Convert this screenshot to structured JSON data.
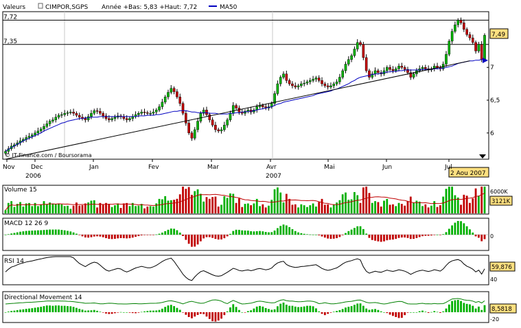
{
  "header": {
    "valeurs_label": "Valeurs",
    "symbol": "CIMPOR,SGPS",
    "range_text": "Année +Bas: 5,83 +Haut: 7,72",
    "ma_label": "MA50"
  },
  "colors": {
    "up": "#00b000",
    "down": "#c00000",
    "ma": "#0000c0",
    "trend": "#000000",
    "highlight": "#ffe080",
    "volume_avg": "#c00000",
    "dm_line": "#008000"
  },
  "chart_data": [
    {
      "type": "candlestick",
      "title": "CIMPOR,SGPS",
      "ylim": [
        5.6,
        7.85
      ],
      "y_ticks": [
        "7,72",
        "7,35",
        "7",
        "6,5",
        "6"
      ],
      "y_tick_values": [
        7.72,
        7.35,
        7.0,
        6.5,
        6.0
      ],
      "reference_lines": [
        7.72,
        7.35
      ],
      "x_month_labels": [
        "Nov",
        "Dec",
        "Jan",
        "Fev",
        "Mar",
        "Avr",
        "Mai",
        "Jun",
        "Jul"
      ],
      "year_labels": [
        "2006",
        "2007"
      ],
      "last_value_label": "7,49",
      "date_label": "2 Aou 2007",
      "watermark": "© IT-Finance.com / Boursorama",
      "ma_series_name": "MA50",
      "close": [
        5.72,
        5.76,
        5.8,
        5.82,
        5.85,
        5.88,
        5.9,
        5.93,
        5.95,
        5.97,
        6.0,
        6.03,
        6.06,
        6.1,
        6.14,
        6.18,
        6.2,
        6.24,
        6.27,
        6.28,
        6.3,
        6.31,
        6.32,
        6.3,
        6.27,
        6.24,
        6.22,
        6.2,
        6.25,
        6.3,
        6.34,
        6.33,
        6.3,
        6.26,
        6.22,
        6.2,
        6.22,
        6.24,
        6.26,
        6.25,
        6.22,
        6.2,
        6.22,
        6.25,
        6.28,
        6.3,
        6.32,
        6.31,
        6.3,
        6.3,
        6.32,
        6.35,
        6.4,
        6.47,
        6.55,
        6.62,
        6.68,
        6.63,
        6.55,
        6.45,
        6.3,
        6.15,
        6.0,
        5.92,
        6.05,
        6.18,
        6.3,
        6.35,
        6.28,
        6.2,
        6.12,
        6.05,
        6.03,
        6.05,
        6.12,
        6.2,
        6.3,
        6.42,
        6.38,
        6.32,
        6.3,
        6.33,
        6.35,
        6.32,
        6.35,
        6.4,
        6.42,
        6.4,
        6.38,
        6.4,
        6.45,
        6.6,
        6.75,
        6.85,
        6.9,
        6.8,
        6.75,
        6.72,
        6.7,
        6.72,
        6.75,
        6.76,
        6.78,
        6.8,
        6.82,
        6.84,
        6.8,
        6.75,
        6.72,
        6.7,
        6.72,
        6.75,
        6.78,
        6.85,
        6.95,
        7.05,
        7.12,
        7.18,
        7.28,
        7.38,
        7.35,
        7.15,
        6.95,
        6.85,
        6.9,
        6.95,
        6.92,
        6.9,
        6.95,
        7.0,
        6.97,
        6.95,
        6.98,
        7.02,
        7.0,
        6.97,
        6.92,
        6.85,
        6.9,
        6.95,
        6.98,
        7.0,
        6.98,
        6.96,
        6.98,
        7.02,
        7.0,
        6.98,
        7.05,
        7.2,
        7.4,
        7.55,
        7.65,
        7.72,
        7.68,
        7.58,
        7.5,
        7.45,
        7.38,
        7.25,
        7.35,
        7.12,
        7.49
      ],
      "ma": [
        5.72,
        5.75,
        5.78,
        5.8,
        5.83,
        5.85,
        5.88,
        5.9,
        5.92,
        5.94,
        5.96,
        5.98,
        6.0,
        6.03,
        6.05,
        6.07,
        6.09,
        6.11,
        6.13,
        6.15,
        6.16,
        6.18,
        6.19,
        6.2,
        6.21,
        6.22,
        6.22,
        6.23,
        6.23,
        6.24,
        6.24,
        6.24,
        6.25,
        6.25,
        6.25,
        6.25,
        6.25,
        6.25,
        6.25,
        6.25,
        6.25,
        6.25,
        6.25,
        6.25,
        6.25,
        6.26,
        6.26,
        6.26,
        6.27,
        6.27,
        6.27,
        6.28,
        6.28,
        6.29,
        6.3,
        6.31,
        6.32,
        6.33,
        6.33,
        6.34,
        6.34,
        6.34,
        6.33,
        6.32,
        6.32,
        6.31,
        6.31,
        6.31,
        6.31,
        6.3,
        6.3,
        6.3,
        6.29,
        6.29,
        6.29,
        6.29,
        6.3,
        6.3,
        6.31,
        6.31,
        6.32,
        6.32,
        6.33,
        6.33,
        6.34,
        6.35,
        6.36,
        6.37,
        6.38,
        6.39,
        6.4,
        6.42,
        6.44,
        6.45,
        6.47,
        6.48,
        6.49,
        6.5,
        6.51,
        6.52,
        6.53,
        6.54,
        6.55,
        6.56,
        6.57,
        6.59,
        6.6,
        6.61,
        6.62,
        6.63,
        6.64,
        6.66,
        6.67,
        6.69,
        6.71,
        6.73,
        6.75,
        6.78,
        6.8,
        6.83,
        6.85,
        6.86,
        6.87,
        6.88,
        6.89,
        6.9,
        6.9,
        6.91,
        6.92,
        6.93,
        6.93,
        6.94,
        6.94,
        6.95,
        6.95,
        6.96,
        6.96,
        6.96,
        6.96,
        6.96,
        6.96,
        6.97,
        6.97,
        6.97,
        6.97,
        6.98,
        6.98,
        6.98,
        6.99,
        7.0,
        7.01,
        7.02,
        7.04,
        7.06,
        7.07,
        7.08,
        7.09,
        7.1,
        7.1,
        7.11,
        7.11,
        7.12,
        7.12
      ],
      "trendline": [
        [
          0,
          5.6
        ],
        [
          157,
          7.1
        ]
      ]
    },
    {
      "type": "bar",
      "title": "Volume 15",
      "y_ticks": [
        "6000K",
        "3121K"
      ],
      "last_value_label": "3121K"
    },
    {
      "type": "bar",
      "title": "MACD 12 26 9",
      "y_ticks": [
        "0"
      ]
    },
    {
      "type": "line",
      "title": "RSI 14",
      "y_ticks": [
        "59,876",
        "40"
      ],
      "last_value_label": "59,876"
    },
    {
      "type": "bar",
      "title": "Directional Movement 14",
      "y_ticks": [
        "8,5818",
        "-20"
      ],
      "last_value_label": "8,5818"
    }
  ]
}
